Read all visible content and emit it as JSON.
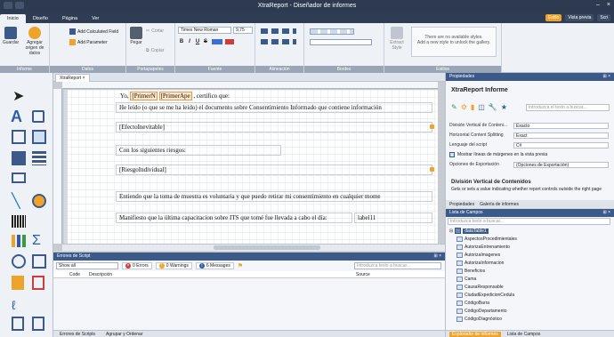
{
  "window": {
    "title": "XtraReport - Diseñador de informes"
  },
  "tabs": [
    {
      "label": "Inicio",
      "active": true
    },
    {
      "label": "Diseño"
    },
    {
      "label": "Página"
    },
    {
      "label": "Ver"
    }
  ],
  "tabs_right": {
    "orange_label": "Estilo",
    "preview_label": "Vista previa",
    "script_label": "Scri"
  },
  "ribbon": {
    "informe": {
      "caption": "Informe",
      "save": "Guardar",
      "add_source": "Agregar origen de datos"
    },
    "datos": {
      "caption": "Datos",
      "add_calc": "Add Calculated Field",
      "add_param": "Add Parameter"
    },
    "portapapeles": {
      "caption": "Portapapeles",
      "paste": "Pegar",
      "cut": "Cortar",
      "copy": "Copiar"
    },
    "fuente": {
      "caption": "Fuente",
      "font_name": "Times New Roman",
      "font_size": "9,75",
      "bold": "B",
      "italic": "I",
      "underline": "U",
      "strike": "S"
    },
    "alineacion": {
      "caption": "Alineación"
    },
    "bordes": {
      "caption": "Bordes"
    },
    "estilos": {
      "caption": "Estilos",
      "extract": "Extract Style",
      "no_styles_1": "There are no available styles.",
      "no_styles_2": "Add a new style to unlock the gallery."
    }
  },
  "document": {
    "tab": "XtraReport"
  },
  "report": {
    "yo": "Yo,",
    "primer_nombre": "[PrimerN",
    "primer_apellido": "[PrimerApe",
    "certifico": ", certifico que:",
    "leido": "He leído (o que se me ha leído) el documento sobre Consentimiento Informado que contiene información",
    "efecto": "[EfectoInevitable]",
    "riesgos": "Con los siguientes riesgos:",
    "riesgo_ind": "[RiesgoIndividual]",
    "entiendo": "Entiendo que la toma de muestra es voluntaria y que puedo retirar mi consentimiento en cualquier mome",
    "manifiesto": "Manifiesto que la última capacitacion sobre ITS que tomé fue llevada a cabo el día:",
    "label": "label11"
  },
  "errors": {
    "panel_title": "Errores de Script",
    "filter": "Show all",
    "errors_count": "0 Errors",
    "warnings_count": "0 Warnings",
    "messages_count": "6 Messages",
    "search_placeholder": "Introduzca texto a buscar...",
    "col_code": "Code",
    "col_desc": "Descripción",
    "col_source": "Source"
  },
  "bottom_tabs": {
    "scripts": "Errores de Scripts",
    "group": "Agrupar y Ordenar"
  },
  "properties": {
    "panel_title": "Propiedades",
    "object": "XtraReport  Informe",
    "search_placeholder": "Introduzca el texto a buscar...",
    "rows": [
      {
        "label": "División Vertical de Conteni...",
        "value": "Exacto"
      },
      {
        "label": "Horizontal Content Splitting",
        "value": "Exact"
      },
      {
        "label": "Lenguaje del script",
        "value": "C#"
      }
    ],
    "check_label": "Mostrar líneas de márgenes en la vista previa",
    "export_label": "Opciones de Exportación",
    "export_value": "(Opciones de Exportación)",
    "desc_title": "División Vertical de Contenidos",
    "desc_text": "Gets or sets a value indicating whether report controls outside the right page",
    "tab_props": "Propiedades",
    "tab_gallery": "Galería de informes"
  },
  "field_list": {
    "panel_title": "Lista de Campos",
    "search_placeholder": "Introduzca texto a buscar...",
    "root": "dataTable1",
    "fields": [
      "AspectosProcedimientales",
      "AutorizaEntrenamiento",
      "AutorizaImagenes",
      "AutorizaInformacion",
      "Beneficios",
      "Cama",
      "CausaResponsable",
      "CiudadExpedicionCedula",
      "CódigoBarra",
      "CódigoDepartamento",
      "CódigoDiagnóstico"
    ],
    "tab_explorer": "Explorador de informes",
    "tab_fields": "Lista de Campos"
  }
}
